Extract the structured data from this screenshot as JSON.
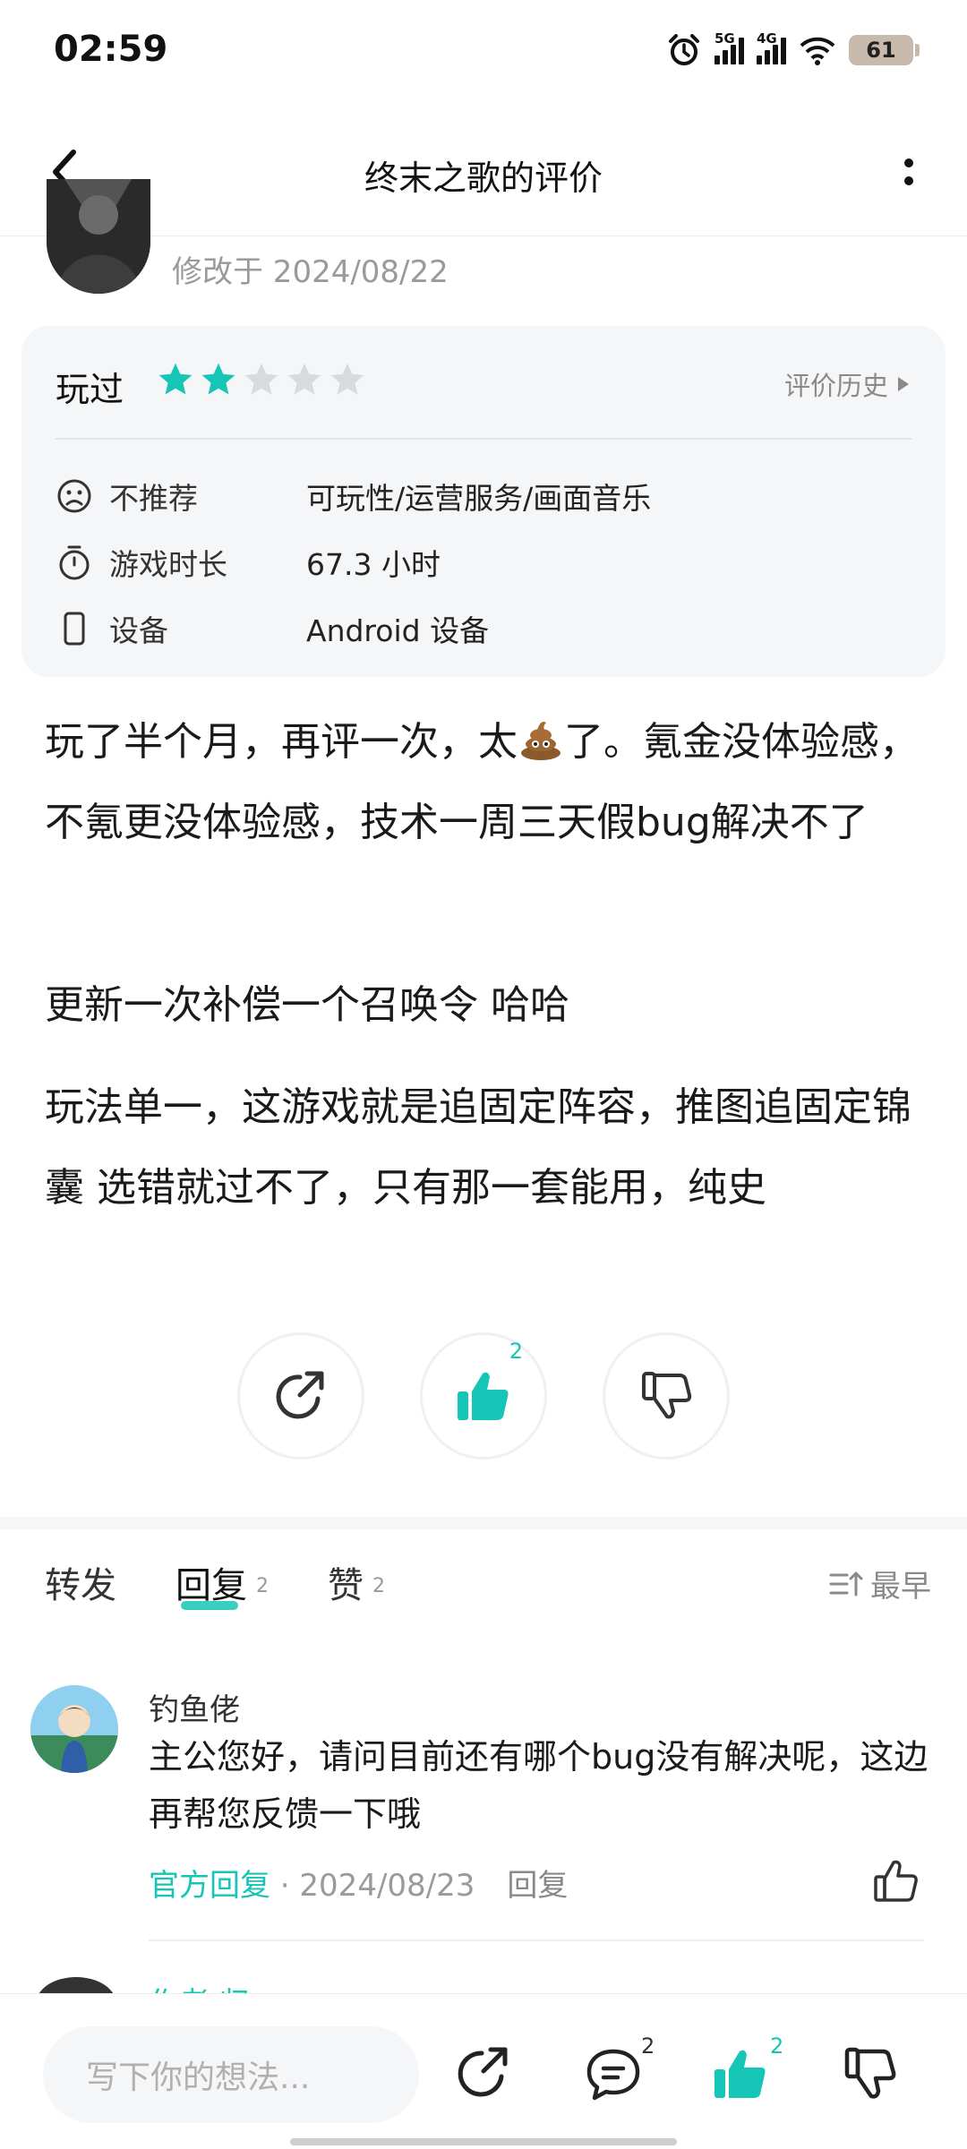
{
  "status_bar": {
    "time": "02:59",
    "battery": "61",
    "sig1_label": "5G",
    "sig2_label": "4G",
    "icons": [
      "alarm-icon",
      "signal-5g-icon",
      "signal-4g-icon",
      "wifi-icon",
      "battery-icon"
    ]
  },
  "header": {
    "title": "终末之歌的评价"
  },
  "review": {
    "modified": "修改于 2024/08/22",
    "played_label": "玩过",
    "rating": 2,
    "rating_max": 5,
    "history_label": "评价历史",
    "rows": [
      {
        "key": "不推荐",
        "value": "可玩性/运营服务/画面音乐",
        "icon": "sad-face-icon"
      },
      {
        "key": "游戏时长",
        "value": "67.3 小时",
        "icon": "stopwatch-icon"
      },
      {
        "key": "设备",
        "value": "Android 设备",
        "icon": "phone-icon"
      }
    ],
    "text_part_a": "玩了半个月，再评一次，太",
    "text_part_b": "了。氪金没体验感，不氪更没体验感，技术一周三天假bug解决不了",
    "paragraph2": "更新一次补偿一个召唤令 哈哈",
    "paragraph3": "玩法单一，这游戏就是追固定阵容，推图追固定锦囊 选错就过不了，只有那一套能用，纯史",
    "like_count": "2"
  },
  "tabs": {
    "items": [
      {
        "label": "转发",
        "count": ""
      },
      {
        "label": "回复",
        "count": "2"
      },
      {
        "label": "赞",
        "count": "2"
      }
    ],
    "sort_label": "最早"
  },
  "comment": {
    "name": "钓鱼佬",
    "text": "主公您好，请问目前还有哪个bug没有解决呢，这边再帮您反馈一下哦",
    "official": "官方回复",
    "date": " · 2024/08/23",
    "reply": "回复"
  },
  "next_comment": {
    "name": "作者 归"
  },
  "bottom_bar": {
    "placeholder": "写下你的想法...",
    "comment_count": "2",
    "like_count": "2"
  },
  "colors": {
    "accent": "#15c5b5",
    "card_bg": "#f5f6f8",
    "muted": "#9a9a9a"
  }
}
